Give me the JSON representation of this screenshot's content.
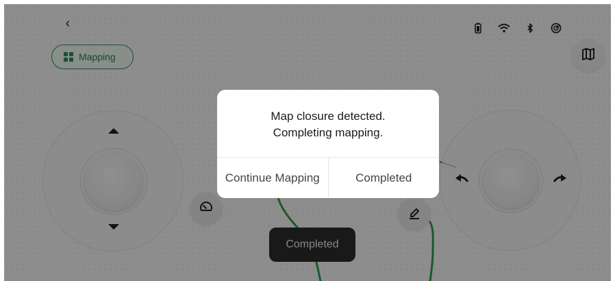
{
  "nav": {
    "back_glyph": "‹",
    "back_icon": "chevron-left-icon"
  },
  "mode_chip": {
    "label": "Mapping",
    "icon": "grid-icon",
    "color": "#2e8b57"
  },
  "status_bar": {
    "icons": [
      "battery-icon",
      "wifi-icon",
      "bluetooth-icon",
      "radar-icon"
    ]
  },
  "map_button": {
    "icon": "map-icon"
  },
  "tools": {
    "speed_icon": "speedometer-icon",
    "edit_icon": "eraser-icon"
  },
  "toast": {
    "text": "Completed"
  },
  "dialog": {
    "line1": "Map closure detected.",
    "line2": "Completing mapping.",
    "continue_label": "Continue Mapping",
    "complete_label": "Completed"
  },
  "colors": {
    "path": "#2e9a46",
    "overlay": "rgba(0,0,0,0.42)",
    "accent": "#2e8b57"
  }
}
